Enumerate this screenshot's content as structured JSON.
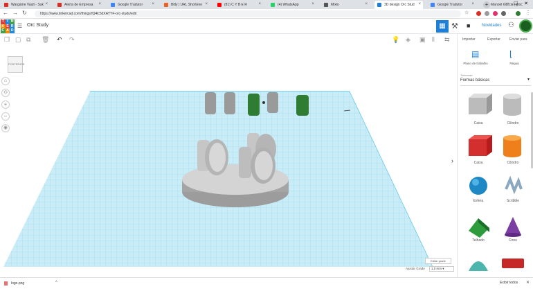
{
  "tabs": [
    {
      "label": "Wargame Vault - Suk",
      "color": "#d93025"
    },
    {
      "label": "Alerta de Empresa",
      "color": "#d93025"
    },
    {
      "label": "Google Tradutor",
      "color": "#4285f4"
    },
    {
      "label": "Bitly | URL Shortene",
      "color": "#ee6123"
    },
    {
      "label": "(81) C Y B E R",
      "color": "#ff0000"
    },
    {
      "label": "(4) WhatsApp",
      "color": "#25d366"
    },
    {
      "label": "Mixlo",
      "color": "#555555"
    },
    {
      "label": "3D design Orc Stud",
      "color": "#1d7fd8"
    },
    {
      "label": "Google Tradutor",
      "color": "#4285f4"
    },
    {
      "label": "Manoel Garcia (@oc",
      "color": "#1da1f2"
    }
  ],
  "address": {
    "url": "https://www.tinkercad.com/things/fQ4lc5dXAYYF-orc-study/edit"
  },
  "logo_letters": [
    "T",
    "I",
    "N",
    "K",
    "E",
    "R",
    "C",
    "A",
    "D"
  ],
  "header": {
    "title": "Orc Study",
    "novidades": "Novidades"
  },
  "toolbar": {
    "importar": "Importar",
    "exportar": "Exportar",
    "enviar_para": "Enviar para"
  },
  "side_tools": {
    "plano": "Plano de trabalho",
    "regua": "Régua"
  },
  "library": {
    "caption": "Tinkercad",
    "selected": "Formas básicas"
  },
  "shapes": [
    {
      "label": "Caixa",
      "icon": "box-striped-icon"
    },
    {
      "label": "Cilindro",
      "icon": "cylinder-striped-icon"
    },
    {
      "label": "Caixa",
      "icon": "box-icon"
    },
    {
      "label": "Cilindro",
      "icon": "cylinder-icon"
    },
    {
      "label": "Esfera",
      "icon": "sphere-icon"
    },
    {
      "label": "Scribble",
      "icon": "scribble-icon"
    },
    {
      "label": "Telhado",
      "icon": "roof-icon"
    },
    {
      "label": "Cone",
      "icon": "cone-icon"
    }
  ],
  "viewcube": {
    "label": "POSTERIOR"
  },
  "grid": {
    "edit_label": "Editar grade",
    "snap_label": "Ajustar Grade",
    "snap_value": "1,0 mm"
  },
  "download": {
    "file": "logo.png",
    "show_all": "Exibir todos"
  },
  "colors": {
    "accent": "#1d7fd8",
    "grid": "#7fd3ef",
    "grid_bg": "#c9ecf7"
  }
}
